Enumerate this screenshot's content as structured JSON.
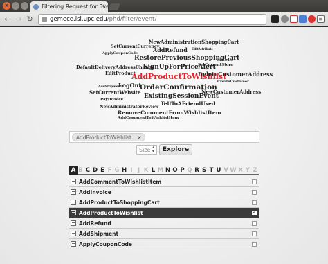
{
  "browser": {
    "tab_title": "Filtering Request for Eve",
    "tab_close": "×",
    "url_host": "gemece.lsi.upc.edu",
    "url_path": "/phd/filter/event/",
    "back": "←",
    "forward": "→",
    "reload": "↻",
    "menu_icon": "≡",
    "colors": {
      "tab_bg": "#e8e8e6",
      "titlebar": "#3a3936",
      "close_btn": "#e4663b"
    },
    "extension_icons": [
      "black-square-icon",
      "gear-icon",
      "gmail-icon",
      "g-icon",
      "opera-icon",
      "blue-square-icon",
      "wrench-icon"
    ]
  },
  "tag_cloud": [
    {
      "text": "NewAdministrationShoppingCart",
      "size": 7
    },
    {
      "text": "SetCurrentCurrency",
      "size": 6.2
    },
    {
      "text": "AddRefund",
      "size": 8
    },
    {
      "text": "EditAttribute",
      "size": 4.2
    },
    {
      "text": "ApplyCouponCode",
      "size": 5
    },
    {
      "text": "RestorePreviousShoppingCart",
      "size": 9
    },
    {
      "text": "EditOrder",
      "size": 4.2
    },
    {
      "text": "DefaultDeliveryAddressChange",
      "size": 6.5
    },
    {
      "text": "SignUpForPriceAlert",
      "size": 9
    },
    {
      "text": "SetCurrentStore",
      "size": 5.5
    },
    {
      "text": "EditProduct",
      "size": 6.5
    },
    {
      "text": "AddProductToWishlist",
      "size": 11,
      "color": "#e8202a"
    },
    {
      "text": "DeleteCustomerAddress",
      "size": 8
    },
    {
      "text": "AddShipment",
      "size": 4.5
    },
    {
      "text": "LogOut",
      "size": 8
    },
    {
      "text": "CreateCustomer",
      "size": 5
    },
    {
      "text": "OrderConfirmation",
      "size": 10.5
    },
    {
      "text": "SetCurrentWebsite",
      "size": 7
    },
    {
      "text": "NewCustomerAddress",
      "size": 7
    },
    {
      "text": "ExistingSessionEvent",
      "size": 9
    },
    {
      "text": "PayInvoice",
      "size": 5.5
    },
    {
      "text": "TellToAFriendUsed",
      "size": 7.5
    },
    {
      "text": "NewAdministratorReview",
      "size": 6
    },
    {
      "text": "RemoveCommentFromWishlistItem",
      "size": 7.5
    },
    {
      "text": "AddCommentToWishlistItem",
      "size": 5.5
    }
  ],
  "search": {
    "chip_label": "AddProductToWishlist",
    "chip_remove": "×"
  },
  "size_select": {
    "value": "Size",
    "arrows": "▴▾"
  },
  "explore_button": "Explore",
  "alphabet": [
    {
      "letter": "A",
      "state": "active"
    },
    {
      "letter": "B",
      "state": "disabled"
    },
    {
      "letter": "C",
      "state": "enabled"
    },
    {
      "letter": "D",
      "state": "enabled"
    },
    {
      "letter": "E",
      "state": "enabled"
    },
    {
      "letter": "F",
      "state": "disabled"
    },
    {
      "letter": "G",
      "state": "disabled"
    },
    {
      "letter": "H",
      "state": "enabled"
    },
    {
      "letter": "I",
      "state": "disabled"
    },
    {
      "letter": "J",
      "state": "disabled"
    },
    {
      "letter": "K",
      "state": "disabled"
    },
    {
      "letter": "L",
      "state": "enabled"
    },
    {
      "letter": "M",
      "state": "disabled"
    },
    {
      "letter": "N",
      "state": "enabled"
    },
    {
      "letter": "O",
      "state": "enabled"
    },
    {
      "letter": "P",
      "state": "enabled"
    },
    {
      "letter": "Q",
      "state": "disabled"
    },
    {
      "letter": "R",
      "state": "enabled"
    },
    {
      "letter": "S",
      "state": "enabled"
    },
    {
      "letter": "T",
      "state": "enabled"
    },
    {
      "letter": "U",
      "state": "enabled"
    },
    {
      "letter": "V",
      "state": "disabled"
    },
    {
      "letter": "W",
      "state": "disabled"
    },
    {
      "letter": "X",
      "state": "disabled"
    },
    {
      "letter": "Y",
      "state": "disabled"
    },
    {
      "letter": "Z",
      "state": "disabled"
    }
  ],
  "events": [
    {
      "label": "AddCommentToWishlistItem",
      "selected": false
    },
    {
      "label": "AddInvoice",
      "selected": false
    },
    {
      "label": "AddProductToShoppingCart",
      "selected": false
    },
    {
      "label": "AddProductToWishlist",
      "selected": true
    },
    {
      "label": "AddRefund",
      "selected": false
    },
    {
      "label": "AddShipment",
      "selected": false
    },
    {
      "label": "ApplyCouponCode",
      "selected": false
    }
  ]
}
